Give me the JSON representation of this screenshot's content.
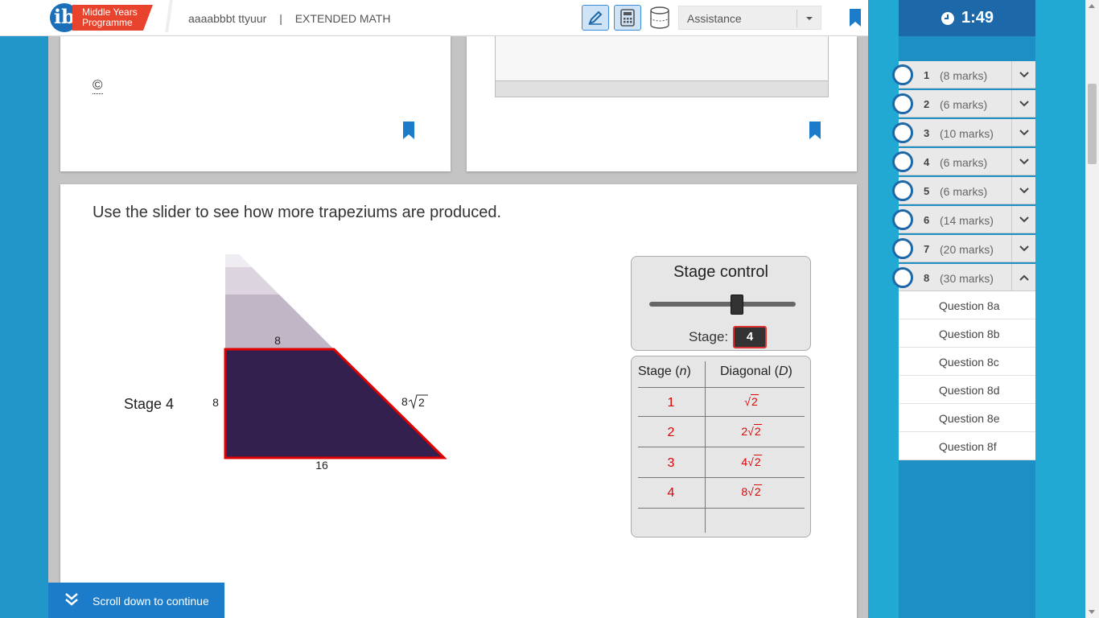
{
  "header": {
    "logo_line1": "Middle Years",
    "logo_line2": "Programme",
    "logo_glyph": "ib",
    "candidate": "aaaabbbt ttyuur",
    "separator": "|",
    "subject": "EXTENDED MATH",
    "assistance_label": "Assistance",
    "tools": [
      "pen-icon",
      "calculator-icon",
      "cylinder-icon"
    ]
  },
  "timer": {
    "value": "1:49",
    "icon": "clock-icon"
  },
  "upper_cards": {
    "copyright": "©"
  },
  "question": {
    "instruction": "Use the slider to see how more trapeziums are produced.",
    "stage_label": "Stage 4",
    "figure": {
      "top_label": "8",
      "left_label": "8",
      "bottom_label": "16",
      "diag_coef": "8",
      "diag_radicand": "2",
      "fill_color": "#33204f",
      "outline_color": "#e00000"
    }
  },
  "stage_control": {
    "title": "Stage control",
    "stage_label": "Stage:",
    "stage_value": "4",
    "slider_value": 4
  },
  "table": {
    "col1_header": "Stage",
    "col1_var": "n",
    "col2_header": "Diagonal",
    "col2_var": "D",
    "rows": [
      {
        "n": "1",
        "coef": "",
        "rad": "2"
      },
      {
        "n": "2",
        "coef": "2",
        "rad": "2"
      },
      {
        "n": "3",
        "coef": "4",
        "rad": "2"
      },
      {
        "n": "4",
        "coef": "8",
        "rad": "2"
      }
    ]
  },
  "scroll_button": {
    "label": "Scroll down to continue"
  },
  "questions": [
    {
      "num": "1",
      "marks": "(8 marks)",
      "expanded": false
    },
    {
      "num": "2",
      "marks": "(6 marks)",
      "expanded": false
    },
    {
      "num": "3",
      "marks": "(10 marks)",
      "expanded": false
    },
    {
      "num": "4",
      "marks": "(6 marks)",
      "expanded": false
    },
    {
      "num": "5",
      "marks": "(6 marks)",
      "expanded": false
    },
    {
      "num": "6",
      "marks": "(14 marks)",
      "expanded": false
    },
    {
      "num": "7",
      "marks": "(20 marks)",
      "expanded": false
    },
    {
      "num": "8",
      "marks": "(30 marks)",
      "expanded": true
    }
  ],
  "sub_questions": [
    "Question 8a",
    "Question 8b",
    "Question 8c",
    "Question 8d",
    "Question 8e",
    "Question 8f"
  ],
  "colors": {
    "accent": "#1c68a8",
    "panel": "#21a9d4",
    "red": "#e00000"
  }
}
